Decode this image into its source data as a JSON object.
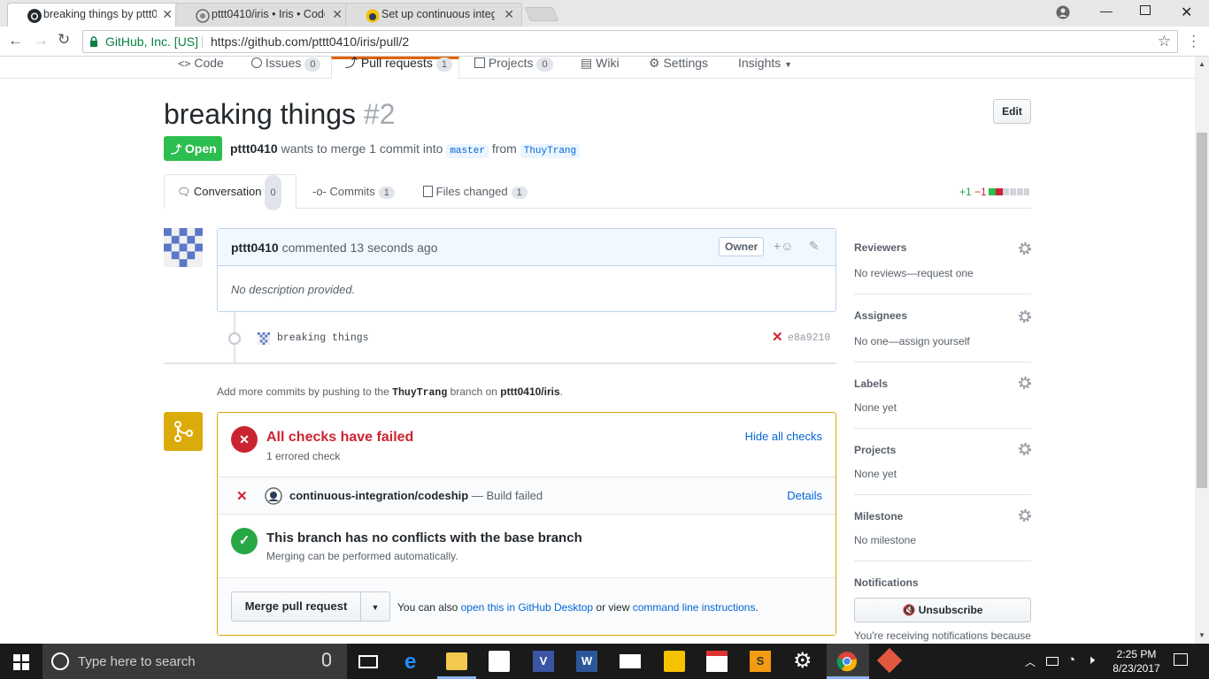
{
  "browser": {
    "tabs": [
      {
        "title": "breaking things by pttt0"
      },
      {
        "title": "pttt0410/iris • Iris • Code"
      },
      {
        "title": "Set up continuous integr"
      }
    ],
    "security_label": "GitHub, Inc. [US]",
    "url": "https://github.com/pttt0410/iris/pull/2"
  },
  "repo_nav": {
    "code": "Code",
    "issues": "Issues",
    "issues_count": "0",
    "pulls": "Pull requests",
    "pulls_count": "1",
    "projects": "Projects",
    "projects_count": "0",
    "wiki": "Wiki",
    "settings": "Settings",
    "insights": "Insights"
  },
  "pr": {
    "title": "breaking things",
    "number": "#2",
    "edit": "Edit",
    "state": "Open",
    "author": "pttt0410",
    "merge_text": "wants to merge 1 commit into",
    "base": "master",
    "from": "from",
    "head": "ThuyTrang"
  },
  "pr_tabs": {
    "conversation": "Conversation",
    "conversation_count": "0",
    "commits": "Commits",
    "commits_count": "1",
    "files": "Files changed",
    "files_count": "1",
    "additions": "+1",
    "deletions": "−1"
  },
  "comment": {
    "author": "pttt0410",
    "action": "commented",
    "time": "13 seconds ago",
    "role": "Owner",
    "body": "No description provided."
  },
  "commit": {
    "message": "breaking things",
    "sha": "e8a9210"
  },
  "push_hint": {
    "prefix": "Add more commits by pushing to the",
    "branch": "ThuyTrang",
    "middle": "branch on",
    "repo": "pttt0410/iris",
    "suffix": "."
  },
  "checks": {
    "title": "All checks have failed",
    "subtitle": "1 errored check",
    "toggle": "Hide all checks",
    "check_name": "continuous-integration/codeship",
    "check_status": "— Build failed",
    "details": "Details",
    "conflict_title": "This branch has no conflicts with the base branch",
    "conflict_sub": "Merging can be performed automatically.",
    "merge_button": "Merge pull request",
    "also_prefix": "You can also",
    "desktop_link": "open this in GitHub Desktop",
    "or_view": "or view",
    "cli_link": "command line instructions",
    "period": "."
  },
  "sidebar": {
    "reviewers": "Reviewers",
    "reviewers_val": "No reviews—request one",
    "assignees": "Assignees",
    "assignees_val": "No one—assign yourself",
    "labels": "Labels",
    "labels_val": "None yet",
    "projects": "Projects",
    "projects_val": "None yet",
    "milestone": "Milestone",
    "milestone_val": "No milestone",
    "notifications": "Notifications",
    "unsubscribe": "Unsubscribe",
    "notif_reason": "You're receiving notifications because"
  },
  "taskbar": {
    "search_placeholder": "Type here to search",
    "time": "2:25 PM",
    "date": "8/23/2017"
  },
  "colors": {
    "open_green": "#2cbe4e",
    "fail_red": "#cb2431",
    "success_green": "#28a745",
    "link_blue": "#0366d6",
    "warn_yellow": "#dbab09"
  }
}
